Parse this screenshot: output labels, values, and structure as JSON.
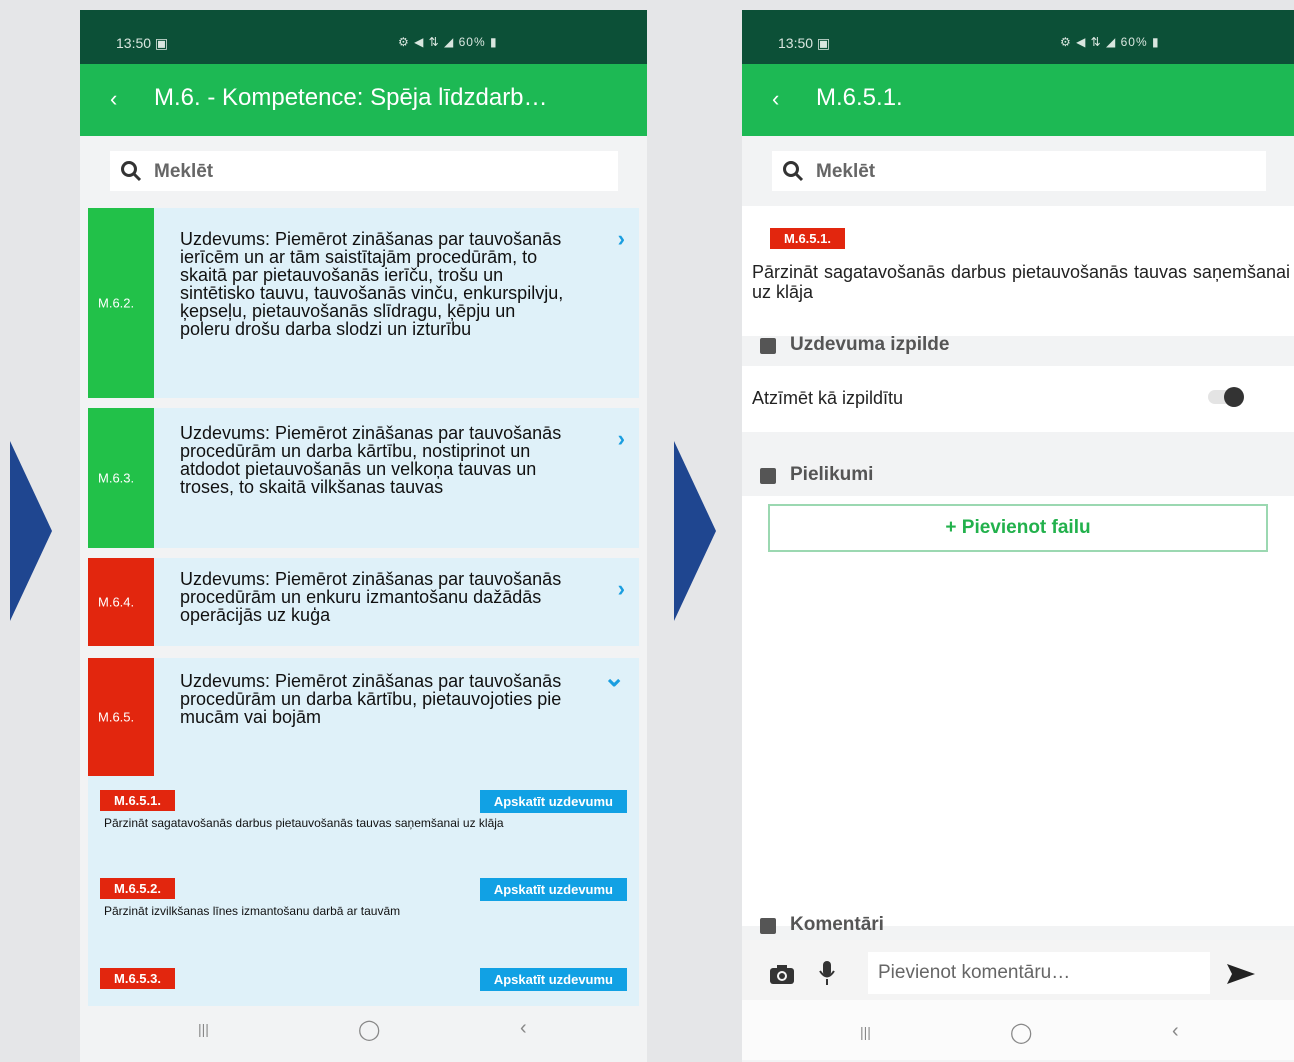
{
  "left_phone": {
    "status": {
      "time": "13:50 ▣",
      "icons": "⚙ ◀ ⇅ ◢ 60% ▮"
    },
    "appbar": {
      "back": "‹",
      "title": "M.6. - Kompetence: Spēja līdzdarb…"
    },
    "search": {
      "placeholder": "Meklēt"
    },
    "tasks": [
      {
        "code": "M.6.2.",
        "status_color": "#22c149",
        "text": "Uzdevums: Piemērot zināšanas par tauvošanās ierīcēm un ar tām saistītajām procedūrām, to skaitā par pietauvošanās ierīču, trošu un sintētisko tauvu, tauvošanās vinču, enkurspilvju, ķepseļu, pietauvošanās slīdragu, ķēpju un poleru drošu darba slodzi un izturību",
        "expanded": false
      },
      {
        "code": "M.6.3.",
        "status_color": "#22c149",
        "text": "Uzdevums: Piemērot zināšanas par tauvošanās procedūrām un darba kārtību, nostiprinot un atdodot pietauvošanās un velkoņa tauvas un troses, to skaitā vilkšanas tauvas",
        "expanded": false
      },
      {
        "code": "M.6.4.",
        "status_color": "#e2260e",
        "text": "Uzdevums: Piemērot zināšanas par tauvošanās procedūrām un enkuru izmantošanu dažādās operācijās uz kuģa",
        "expanded": false
      },
      {
        "code": "M.6.5.",
        "status_color": "#e2260e",
        "text": "Uzdevums: Piemērot zināšanas par tauvošanās procedūrām un darba kārtību, pietauvojoties pie mucām vai bojām",
        "expanded": true
      }
    ],
    "subtasks": [
      {
        "code": "M.6.5.1.",
        "button": "Apskatīt uzdevumu",
        "text": "Pārzināt sagatavošanās darbus pietauvošanās tauvas saņemšanai uz klāja"
      },
      {
        "code": "M.6.5.2.",
        "button": "Apskatīt uzdevumu",
        "text": "Pārzināt izvilkšanas līnes izmantošanu darbā ar tauvām"
      },
      {
        "code": "M.6.5.3.",
        "button": "Apskatīt uzdevumu",
        "text": ""
      }
    ],
    "nav": {
      "recent": "|||",
      "home": "◯",
      "back": "‹"
    }
  },
  "right_phone": {
    "status": {
      "time": "13:50 ▣",
      "icons": "⚙ ◀ ⇅ ◢ 60% ▮"
    },
    "appbar": {
      "back": "‹",
      "title": "M.6.5.1."
    },
    "search": {
      "placeholder": "Meklēt"
    },
    "task_code": "M.6.5.1.",
    "task_text": "Pārzināt sagatavošanās darbus pietauvošanās tauvas saņemšanai uz klāja",
    "sections": {
      "execution": "Uzdevuma izpilde",
      "mark_done": "Atzīmēt kā izpildītu",
      "attachments": "Pielikumi",
      "add_file": "+ Pievienot failu",
      "comments": "Komentāri"
    },
    "comment_input": {
      "placeholder": "Pievienot komentāru…"
    },
    "nav": {
      "recent": "|||",
      "home": "◯",
      "back": "‹"
    }
  },
  "colors": {
    "app_green": "#1db954",
    "status_green": "#0c5037",
    "red": "#e2260e",
    "blue": "#11a1e4",
    "arrow": "#1f4690"
  }
}
